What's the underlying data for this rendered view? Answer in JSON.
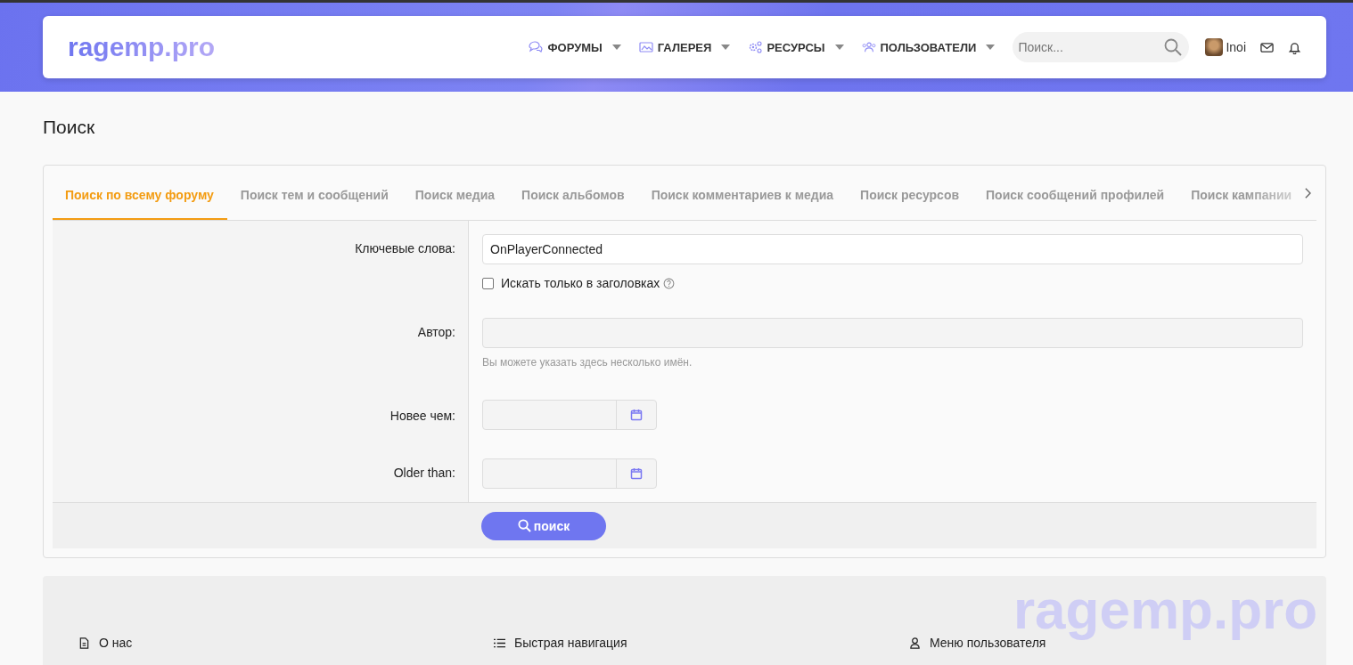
{
  "header": {
    "logo": "ragemp.pro",
    "nav": [
      {
        "label": "ФОРУМЫ"
      },
      {
        "label": "ГАЛЕРЕЯ"
      },
      {
        "label": "РЕСУРСЫ"
      },
      {
        "label": "ПОЛЬЗОВАТЕЛИ"
      }
    ],
    "search": {
      "placeholder": "Поиск..."
    },
    "user": "Inoi"
  },
  "page_title": "Поиск",
  "tabs": [
    {
      "label": "Поиск по всему форуму",
      "selected": true
    },
    {
      "label": "Поиск тем и сообщений",
      "selected": false
    },
    {
      "label": "Поиск медиа",
      "selected": false
    },
    {
      "label": "Поиск альбомов",
      "selected": false
    },
    {
      "label": "Поиск комментариев к медиа",
      "selected": false
    },
    {
      "label": "Поиск ресурсов",
      "selected": false
    },
    {
      "label": "Поиск сообщений профилей",
      "selected": false
    },
    {
      "label": "Поиск кампании",
      "selected": false
    }
  ],
  "form": {
    "keywords": {
      "label": "Ключевые слова:",
      "value": "OnPlayerConnected"
    },
    "titles_only": {
      "label": "Искать только в заголовках",
      "checked": false
    },
    "author": {
      "label": "Автор:",
      "hint": "Вы можете указать здесь несколько имён."
    },
    "newer": {
      "label": "Новее чем:"
    },
    "older": {
      "label": "Older than:"
    },
    "submit": "поиск"
  },
  "footer": {
    "logo": "ragemp.pro",
    "columns": [
      {
        "title": "О нас"
      },
      {
        "title": "Быстрая навигация"
      },
      {
        "title": "Меню пользователя"
      }
    ]
  }
}
